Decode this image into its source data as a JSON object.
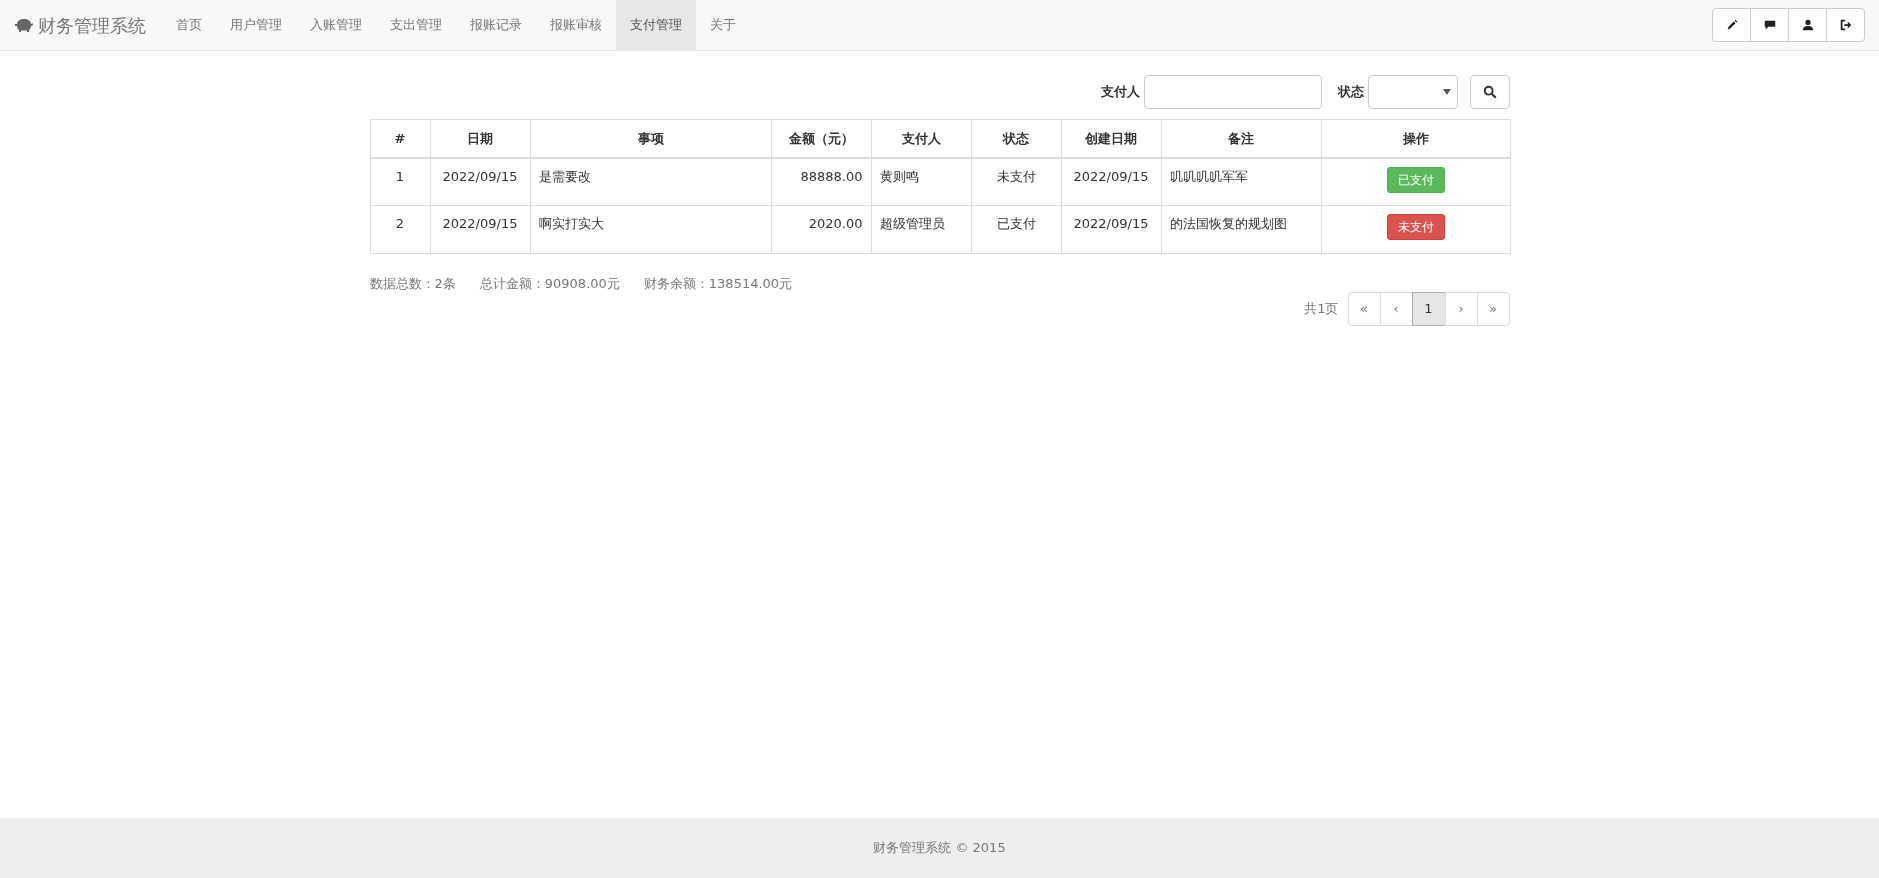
{
  "navbar": {
    "brand": "财务管理系统",
    "items": [
      {
        "label": "首页",
        "selected": false
      },
      {
        "label": "用户管理",
        "selected": false
      },
      {
        "label": "入账管理",
        "selected": false
      },
      {
        "label": "支出管理",
        "selected": false
      },
      {
        "label": "报账记录",
        "selected": false
      },
      {
        "label": "报账审核",
        "selected": false
      },
      {
        "label": "支付管理",
        "selected": true
      },
      {
        "label": "关于",
        "selected": false
      }
    ]
  },
  "search": {
    "payer_label": "支付人",
    "status_label": "状态"
  },
  "table": {
    "columns": [
      "#",
      "日期",
      "事项",
      "金额（元）",
      "支付人",
      "状态",
      "创建日期",
      "备注",
      "操作"
    ],
    "rows": [
      {
        "cells": [
          "1",
          "2022/09/15",
          "是需要改",
          "88888.00",
          "黄则鸣",
          "未支付",
          "2022/09/15",
          "叽叽叽叽军军"
        ],
        "action": {
          "label": "已支付",
          "kind": "success"
        }
      },
      {
        "cells": [
          "2",
          "2022/09/15",
          "啊实打实大",
          "2020.00",
          "超级管理员",
          "已支付",
          "2022/09/15",
          "的法国恢复的规划图"
        ],
        "action": {
          "label": "未支付",
          "kind": "danger"
        }
      }
    ]
  },
  "summary": [
    "数据总数：2条",
    "总计金额：90908.00元",
    "财务余额：138514.00元"
  ],
  "pagination": {
    "total": "共1页",
    "items": [
      {
        "label": "«",
        "selected": false
      },
      {
        "label": "‹",
        "selected": false
      },
      {
        "label": "1",
        "selected": true
      },
      {
        "label": "›",
        "selected": false
      },
      {
        "label": "»",
        "selected": false
      }
    ]
  },
  "footer": "财务管理系统 © 2015"
}
